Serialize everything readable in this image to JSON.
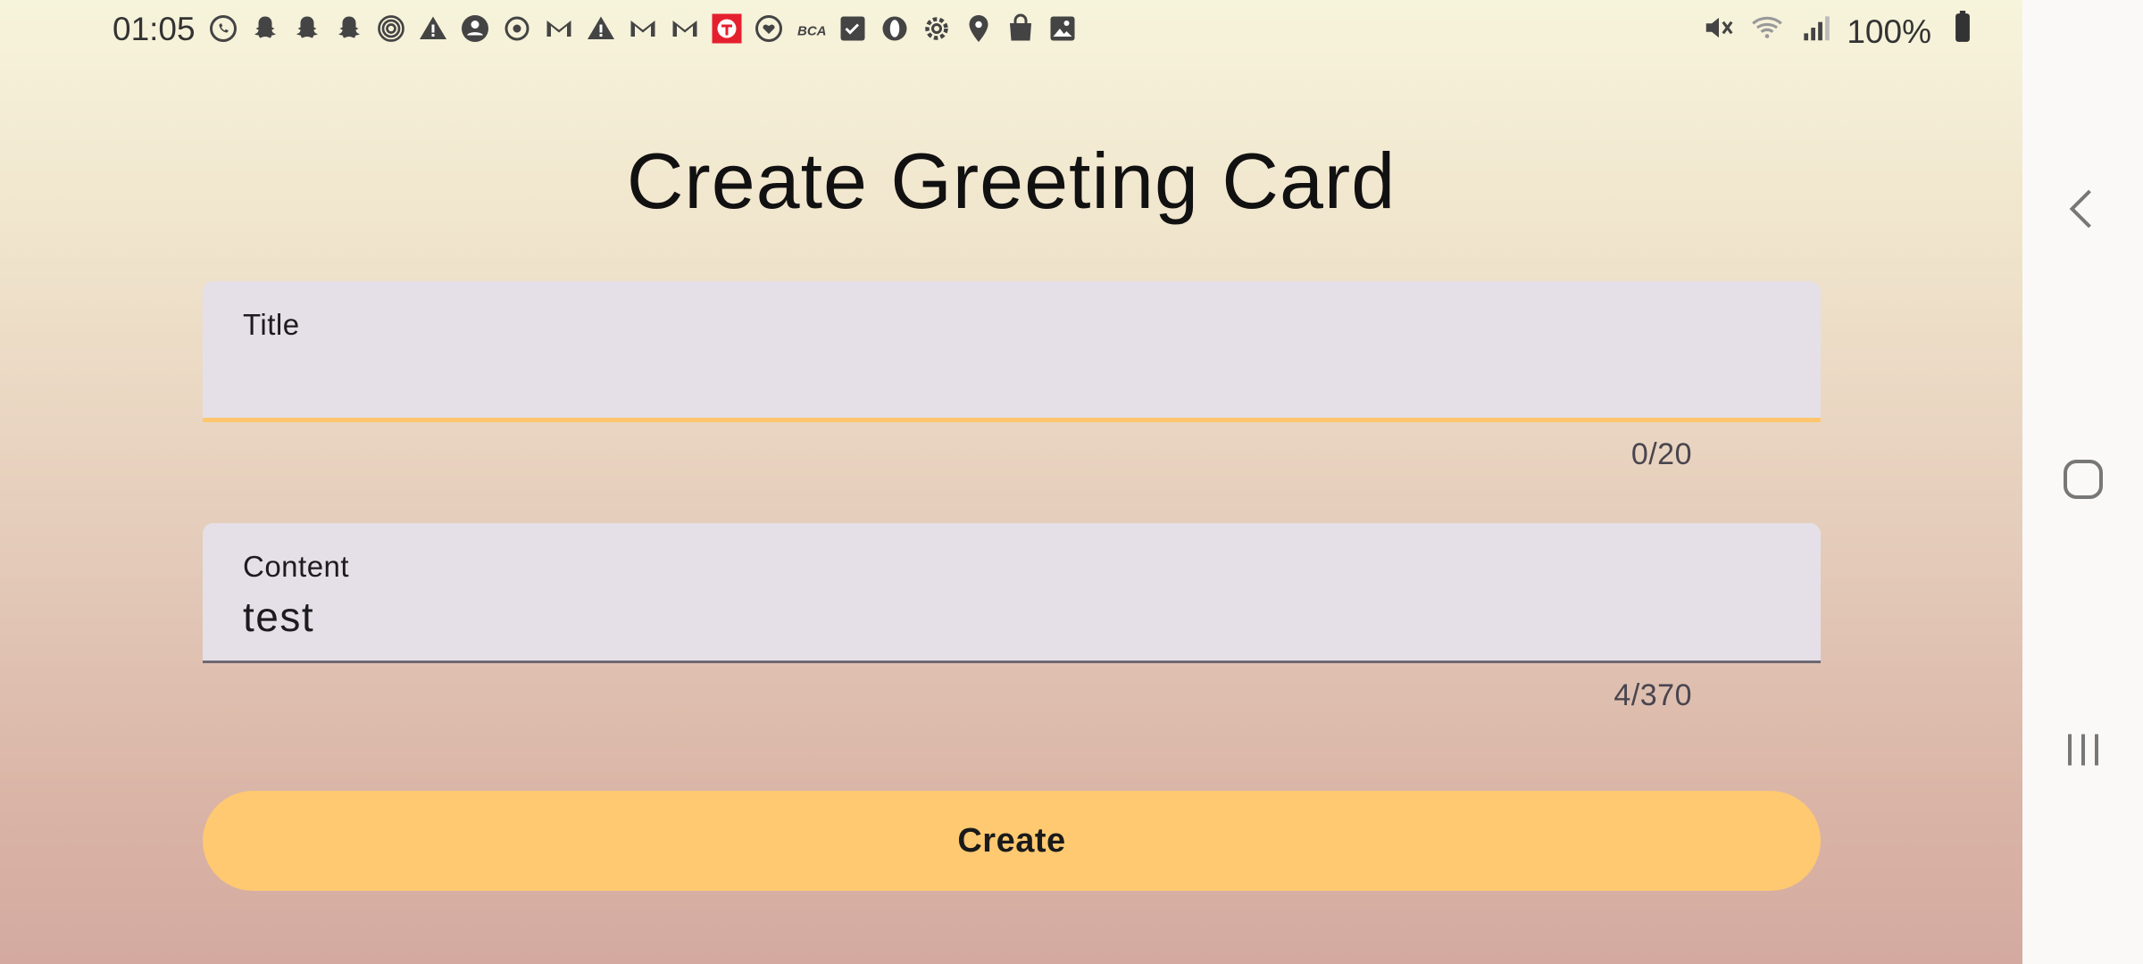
{
  "status_bar": {
    "time": "01:05",
    "battery": "100%",
    "notification_icons": [
      "whatsapp-icon",
      "snapchat-icon",
      "snapchat-icon",
      "snapchat-icon",
      "fingerprint-icon",
      "warning-icon",
      "account-icon",
      "sync-icon",
      "gmail-icon",
      "warning-icon",
      "gmail-icon",
      "gmail-icon",
      "app-t-icon",
      "heart-icon",
      "mybca-icon",
      "checkbox-icon",
      "opera-icon",
      "gear-icon",
      "location-icon",
      "bag-icon",
      "image-icon"
    ],
    "mybca_label": "BCA"
  },
  "page": {
    "title": "Create Greeting Card"
  },
  "form": {
    "title_field": {
      "label": "Title",
      "value": "",
      "counter": "0/20"
    },
    "content_field": {
      "label": "Content",
      "value": "test",
      "counter": "4/370"
    },
    "submit_label": "Create"
  },
  "colors": {
    "accent": "#ffc971",
    "field_bg": "#e5e0e7",
    "focus_line": "#ffc66e"
  }
}
